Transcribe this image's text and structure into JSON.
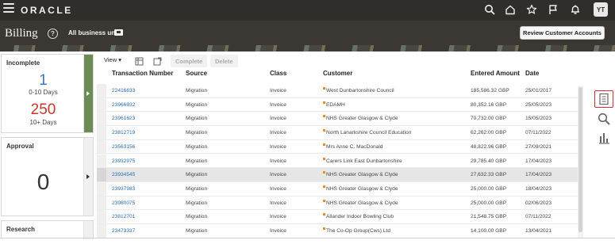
{
  "global_header": {
    "logo": "ORACLE",
    "avatar_initials": "YT",
    "icons": [
      "search-icon",
      "home-icon",
      "star-icon",
      "flag-icon",
      "bell-icon"
    ]
  },
  "page_header": {
    "title": "Billing",
    "business_units_label": "All business units",
    "review_button": "Review Customer Accounts"
  },
  "cards": {
    "incomplete": {
      "title": "Incomplete",
      "count_a": "1",
      "label_a": "0-10 Days",
      "count_b": "250",
      "label_b": "10+ Days"
    },
    "approval": {
      "title": "Approval",
      "count": "0"
    },
    "research": {
      "title": "Research"
    }
  },
  "toolbar": {
    "view_label": "View ▾",
    "complete_label": "Complete",
    "delete_label": "Delete"
  },
  "table": {
    "columns": [
      "Transaction Number",
      "Source",
      "Class",
      "Customer",
      "Entered Amount",
      "Date"
    ],
    "rows": [
      {
        "txn": "22416633",
        "source": "Migration",
        "class": "Invoice",
        "customer": "West Dunbartonshire Council",
        "amount": "185,586.32 GBP",
        "date": "25/01/2017"
      },
      {
        "txn": "23966932",
        "source": "Migration",
        "class": "Invoice",
        "customer": "EDAMH",
        "amount": "80,352.16 GBP",
        "date": "25/05/2023"
      },
      {
        "txn": "23961623",
        "source": "Migration",
        "class": "Invoice",
        "customer": "NHS Greater Glasgow & Clyde",
        "amount": "70,732.00 GBP",
        "date": "15/05/2023"
      },
      {
        "txn": "23812719",
        "source": "Migration",
        "class": "Invoice",
        "customer": "North Lanarkshire Council Education",
        "amount": "62,262.00 GBP",
        "date": "07/11/2022"
      },
      {
        "txn": "23563156",
        "source": "Migration",
        "class": "Invoice",
        "customer": "Mrs Anne C. MacDonald",
        "amount": "48,822.96 GBP",
        "date": "27/09/2021"
      },
      {
        "txn": "23932975",
        "source": "Migration",
        "class": "Invoice",
        "customer": "Carers Link East Dunbartonshire",
        "amount": "29,785.40 GBP",
        "date": "17/04/2023"
      },
      {
        "txn": "23934545",
        "source": "Migration",
        "class": "Invoice",
        "customer": "NHS Greater Glasgow & Clyde",
        "amount": "27,632.33 GBP",
        "date": "17/04/2023"
      },
      {
        "txn": "23937983",
        "source": "Migration",
        "class": "Invoice",
        "customer": "NHS Greater Glasgow & Clyde",
        "amount": "25,000.00 GBP",
        "date": "18/04/2023"
      },
      {
        "txn": "23980075",
        "source": "Migration",
        "class": "Invoice",
        "customer": "NHS Greater Glasgow & Clyde",
        "amount": "25,000.00 GBP",
        "date": "02/06/2023"
      },
      {
        "txn": "23812701",
        "source": "Migration",
        "class": "Invoice",
        "customer": "Allander Indoor Bowling Club",
        "amount": "21,548.75 GBP",
        "date": "07/11/2022"
      },
      {
        "txn": "23473337",
        "source": "Migration",
        "class": "Invoice",
        "customer": "The Co-Op Group(Cws) Ltd",
        "amount": "14,100.00 GBP",
        "date": "13/04/2021"
      }
    ],
    "selected_row_index": 6
  },
  "right_rail": {
    "icons": [
      "list-icon",
      "search-icon",
      "analytics-icon"
    ],
    "active": "list-icon"
  },
  "colors": {
    "header_bg": "#312d2a",
    "accent_green": "#6c8a55",
    "link_blue": "#2a6ebb",
    "count_blue": "#3a7abf",
    "count_red": "#c0392b",
    "flag_orange": "#f08a24",
    "active_rail_border": "#d32f2f"
  }
}
